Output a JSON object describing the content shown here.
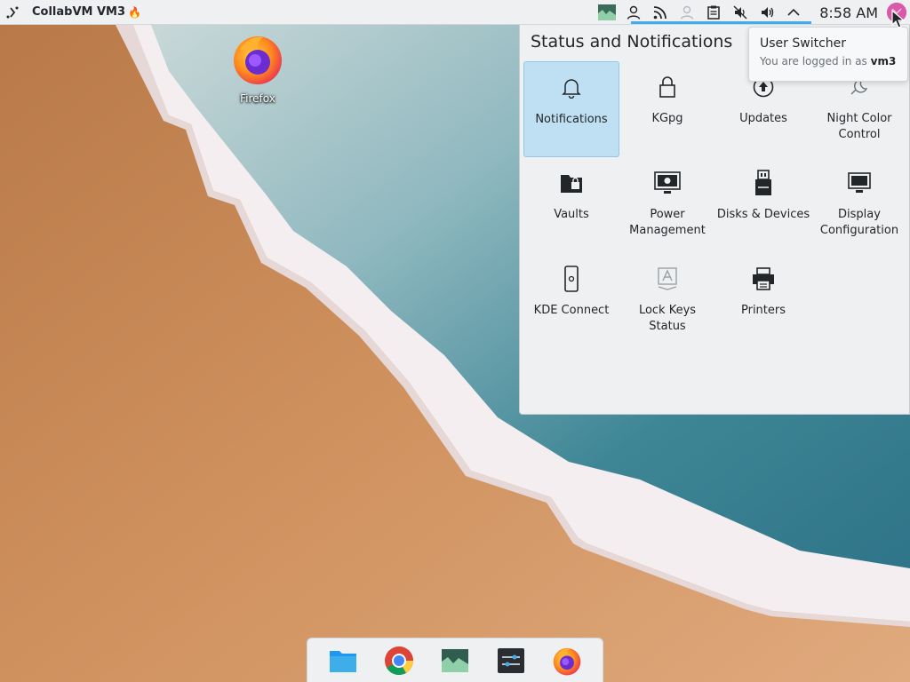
{
  "panel": {
    "app_title": "CollabVM VM3",
    "fire_glyph": "🔥",
    "clock": "8:58 AM",
    "tray_icons": [
      "system-monitor-icon",
      "user-icon",
      "network-icon",
      "user-faded-icon",
      "clipboard-icon",
      "volume-muted-icon",
      "volume-icon",
      "expand-arrow-icon"
    ]
  },
  "desktop": {
    "firefox_label": "Firefox"
  },
  "status_popup": {
    "title": "Status and Notifications",
    "items": [
      {
        "label": "Notifications",
        "icon": "bell-icon"
      },
      {
        "label": "KGpg",
        "icon": "lock-icon"
      },
      {
        "label": "Updates",
        "icon": "update-arrow-icon"
      },
      {
        "label": "Night Color Control",
        "icon": "night-color-icon"
      },
      {
        "label": "Vaults",
        "icon": "vault-icon"
      },
      {
        "label": "Power Management",
        "icon": "power-management-icon"
      },
      {
        "label": "Disks & Devices",
        "icon": "disks-icon"
      },
      {
        "label": "Display Configuration",
        "icon": "display-icon"
      },
      {
        "label": "KDE Connect",
        "icon": "phone-icon"
      },
      {
        "label": "Lock Keys Status",
        "icon": "lock-keys-icon"
      },
      {
        "label": "Printers",
        "icon": "printer-icon"
      }
    ]
  },
  "tooltip": {
    "title": "User Switcher",
    "body_prefix": "You are logged in as ",
    "username": "vm3"
  },
  "dock": {
    "items": [
      "folder-icon",
      "chrome-icon",
      "system-monitor-icon",
      "settings-icon",
      "firefox-icon"
    ]
  },
  "colors": {
    "accent": "#3daee9",
    "selected_bg": "#bfe0f2",
    "panel_bg": "#eef0f2"
  }
}
